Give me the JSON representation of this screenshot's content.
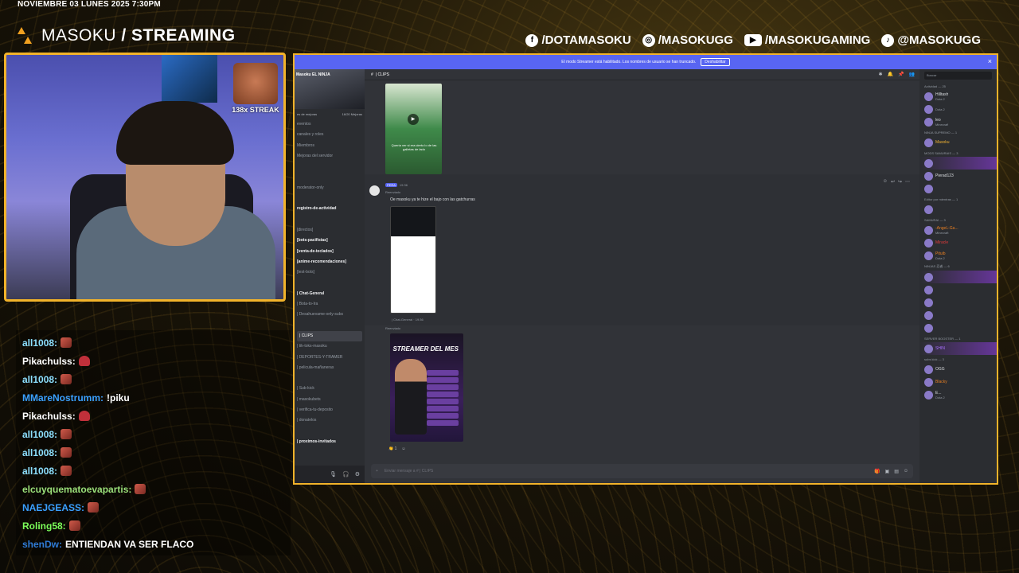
{
  "overlay": {
    "datetime": "NOVIEMBRE 03 LUNES 2025 7:30PM",
    "brand_name": "MASOKU",
    "brand_separator": "/",
    "brand_suffix": "STREAMING",
    "socials": [
      {
        "icon": "facebook-icon",
        "handle": "/DOTAMASOKU"
      },
      {
        "icon": "instagram-icon",
        "handle": "/MASOKUGG"
      },
      {
        "icon": "youtube-icon",
        "handle": "/MASOKUGAMING"
      },
      {
        "icon": "tiktok-icon",
        "handle": "@MASOKUGG"
      }
    ],
    "streak_label": "138x STREAK"
  },
  "chat": [
    {
      "user": "all1008:",
      "color": "#8de0ff",
      "message": "",
      "emote": "emote-face"
    },
    {
      "user": "Pikachulss:",
      "color": "#ffffff",
      "message": "",
      "emote": "emote-heart"
    },
    {
      "user": "all1008:",
      "color": "#8de0ff",
      "message": "",
      "emote": "emote-face"
    },
    {
      "user": "MMareNostrumm:",
      "color": "#3aa0ff",
      "message": "!piku",
      "emote": ""
    },
    {
      "user": "Pikachulss:",
      "color": "#ffffff",
      "message": "",
      "emote": "emote-heart"
    },
    {
      "user": "all1008:",
      "color": "#8de0ff",
      "message": "",
      "emote": "emote-face"
    },
    {
      "user": "all1008:",
      "color": "#8de0ff",
      "message": "",
      "emote": "emote-face"
    },
    {
      "user": "all1008:",
      "color": "#8de0ff",
      "message": "",
      "emote": "emote-face"
    },
    {
      "user": "elcuyquematoevapartis:",
      "color": "#9be07a",
      "message": "",
      "emote": "emote-face"
    },
    {
      "user": "NAEJGEASS:",
      "color": "#3aa0ff",
      "message": "",
      "emote": "emote-face"
    },
    {
      "user": "Roling58:",
      "color": "#7cff5a",
      "message": "",
      "emote": "emote-face"
    },
    {
      "user": "shenDw:",
      "color": "#2e7bd6",
      "message": "ENTIENDAN VA SER FLACO",
      "emote": ""
    }
  ],
  "discord": {
    "banner_text": "El modo Streamer está habilitado. Los nombres de usuario se han truncado.",
    "banner_button": "Deshabilitar",
    "server_name": "Masoku EL NINJA",
    "boost_left": "es de mejoras",
    "boost_right": "16/20 Mejoras",
    "channels": [
      {
        "label": "eventos",
        "style": ""
      },
      {
        "label": "canales y roles",
        "style": ""
      },
      {
        "label": "Miembros",
        "style": ""
      },
      {
        "label": "Mejoras del servidor",
        "style": ""
      },
      {
        "label": "",
        "style": "cat"
      },
      {
        "label": "",
        "style": "white"
      },
      {
        "label": "moderator-only",
        "style": ""
      },
      {
        "label": "",
        "style": "white"
      },
      {
        "label": "registro-de-actividad",
        "style": "white"
      },
      {
        "label": "",
        "style": "cat"
      },
      {
        "label": "[directos]",
        "style": ""
      },
      {
        "label": "[bots-pacifistas]",
        "style": "white"
      },
      {
        "label": "[venta-de-teclados]",
        "style": "white"
      },
      {
        "label": "[anime-recomendaciones]",
        "style": "white"
      },
      {
        "label": "[test-bots]",
        "style": ""
      },
      {
        "label": "",
        "style": "cat"
      },
      {
        "label": "| Chat-General",
        "style": "white"
      },
      {
        "label": "| Bota-to-Ira",
        "style": ""
      },
      {
        "label": "| Desahuevame-only-subs",
        "style": ""
      },
      {
        "label": "",
        "style": "cat"
      },
      {
        "label": "| CLIPS",
        "style": "active"
      },
      {
        "label": "| tik-toks-masoku",
        "style": ""
      },
      {
        "label": "| DEPORTES-Y-TRAMER",
        "style": ""
      },
      {
        "label": "| pelicula-mañaneras",
        "style": ""
      },
      {
        "label": "",
        "style": "cat"
      },
      {
        "label": "| Sub-kick",
        "style": ""
      },
      {
        "label": "| masokubets",
        "style": ""
      },
      {
        "label": "| verifica-tu-deposito",
        "style": ""
      },
      {
        "label": "| donatelos",
        "style": ""
      },
      {
        "label": "",
        "style": "cat"
      },
      {
        "label": "| proximos-invitados",
        "style": "white"
      }
    ],
    "channel_header": "| CLIPS",
    "clip_caption": "Quería ver si era cierto lo de las galletas de lado",
    "message_badge": "PERA",
    "message_time": "19:36",
    "reply_label_1": "Reenviado",
    "message_text": "Oe masoku ya te hize el bajo con las gatchurras",
    "forward_from": "| Chat-General · 19:36",
    "reply_label_2": "Reenviado",
    "poster_title": "STREAMER DEL MES",
    "reaction_count": "1",
    "composer_placeholder": "Enviar mensaje a # | CLIPS",
    "search_placeholder": "Buscar",
    "member_groups": [
      {
        "title": "Actividad — 25",
        "members": [
          {
            "name": "Hilltash",
            "color": "",
            "sub": "Dota 2"
          },
          {
            "name": "",
            "color": "",
            "sub": "Dota 2"
          },
          {
            "name": "leo",
            "color": "",
            "sub": "Minecraft"
          }
        ]
      },
      {
        "title": "NINJA SUPREMO — 1",
        "members": [
          {
            "name": "Masoku",
            "color": "gold",
            "sub": ""
          }
        ]
      },
      {
        "title": "MODS SAMURAIS — 3",
        "members": [
          {
            "name": "",
            "color": "purple",
            "sub": ""
          },
          {
            "name": "Pierad123",
            "color": "",
            "sub": ""
          },
          {
            "name": "",
            "color": "red",
            "sub": ""
          }
        ]
      },
      {
        "title": "Editor por mientras — 1",
        "members": [
          {
            "name": "",
            "color": "red",
            "sub": ""
          }
        ]
      },
      {
        "title": "SAMURAI — 3",
        "members": [
          {
            "name": "-AngeL-Ga...",
            "color": "orange",
            "sub": "Minecraft"
          },
          {
            "name": "Miracle",
            "color": "red",
            "sub": ""
          },
          {
            "name": "Pituib",
            "color": "orange",
            "sub": "Dota 2"
          }
        ]
      },
      {
        "title": "NINJAS 忍者 — 6",
        "members": [
          {
            "name": "",
            "color": "purple",
            "sub": ""
          },
          {
            "name": "",
            "color": "red",
            "sub": ""
          },
          {
            "name": "",
            "color": "red",
            "sub": ""
          },
          {
            "name": "",
            "color": "red",
            "sub": ""
          },
          {
            "name": "",
            "color": "red",
            "sub": ""
          }
        ]
      },
      {
        "title": "SERVER BOOSTER — 1",
        "members": [
          {
            "name": "SHIN",
            "color": "purple",
            "sub": ""
          }
        ]
      },
      {
        "title": "subs kick — 3",
        "members": [
          {
            "name": "OGG",
            "color": "",
            "sub": ""
          },
          {
            "name": "Blacky",
            "color": "orange",
            "sub": ""
          },
          {
            "name": "E...",
            "color": "",
            "sub": "Dota 2"
          }
        ]
      }
    ]
  }
}
